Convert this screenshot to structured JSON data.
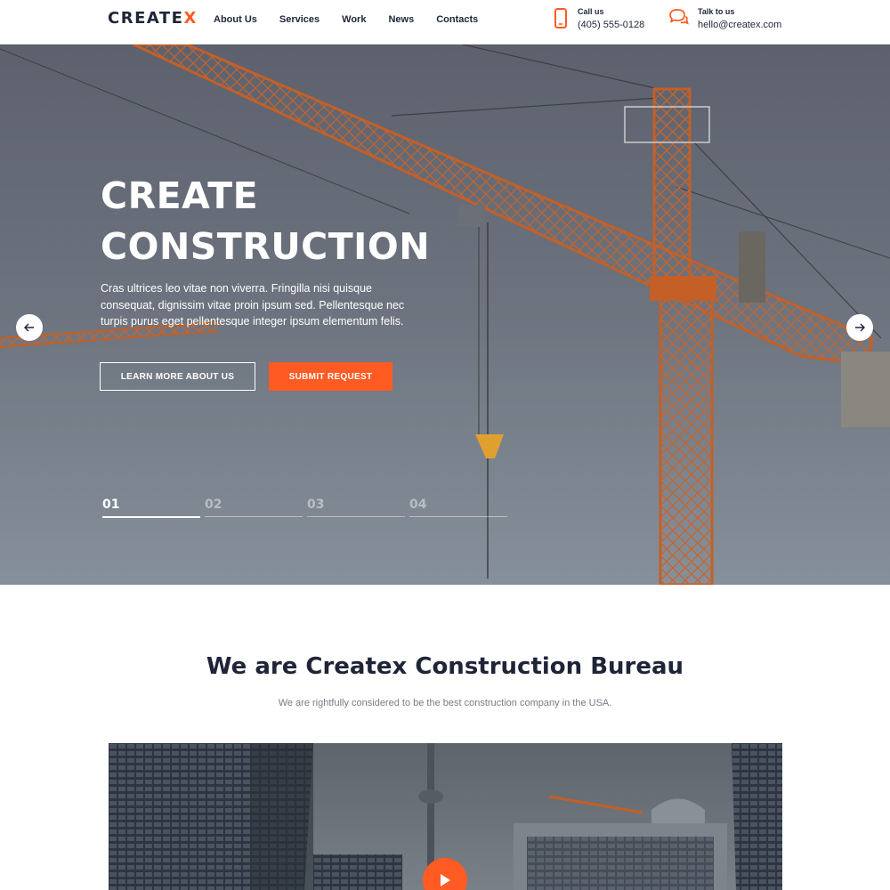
{
  "header": {
    "logo": {
      "main": "CREATE",
      "accent": "X"
    },
    "nav": [
      "About Us",
      "Services",
      "Work",
      "News",
      "Contacts"
    ],
    "phone": {
      "label": "Call us",
      "value": "(405) 555-0128",
      "icon": "phone-icon"
    },
    "email": {
      "label": "Talk to us",
      "value": "hello@createx.com",
      "icon": "chat-icon"
    }
  },
  "hero": {
    "title_line1": "CREATE",
    "title_line2": "CONSTRUCTION",
    "description": "Cras ultrices leo vitae non viverra. Fringilla nisi quisque consequat, dignissim vitae proin ipsum sed. Pellentesque nec turpis purus eget pellentesque integer ipsum elementum felis.",
    "button_secondary": "LEARN MORE ABOUT US",
    "button_primary": "SUBMIT REQUEST",
    "prev_icon": "arrow-left-icon",
    "next_icon": "arrow-right-icon",
    "slides": [
      "01",
      "02",
      "03",
      "04"
    ],
    "active_slide": 0
  },
  "about": {
    "title": "We are Createx Construction Bureau",
    "subtitle": "We are rightfully considered to be the best construction company in the USA."
  },
  "video": {
    "play_icon": "play-icon"
  },
  "colors": {
    "accent": "#ff5b22",
    "dark": "#1f2537",
    "muted": "#777c86"
  }
}
